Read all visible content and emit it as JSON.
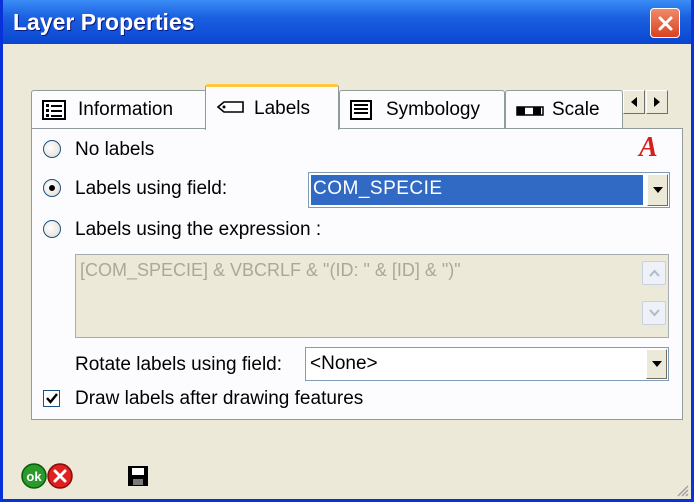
{
  "window": {
    "title": "Layer Properties"
  },
  "tabs": [
    {
      "label": "Information",
      "icon": "info-list-icon"
    },
    {
      "label": "Labels",
      "icon": "label-tag-icon",
      "active": true
    },
    {
      "label": "Symbology",
      "icon": "symbology-icon"
    },
    {
      "label": "Scale",
      "icon": "scale-icon"
    }
  ],
  "labels_panel": {
    "options": {
      "no_labels": "No labels",
      "using_field": "Labels using field:",
      "using_expression": "Labels using the expression :"
    },
    "selected_option": "using_field",
    "field_value": "COM_SPECIE",
    "expression_value": "[COM_SPECIE] & VBCRLF & \"(ID: \" & [ID] & \")\"",
    "rotate_label": "Rotate labels using field:",
    "rotate_value": "<None>",
    "draw_after_label": "Draw labels after drawing features",
    "draw_after_checked": true,
    "font_icon_letter": "A"
  },
  "colors": {
    "title_bar": "#0a46d0",
    "selection": "#316ac5",
    "font_icon": "#d6201f"
  }
}
